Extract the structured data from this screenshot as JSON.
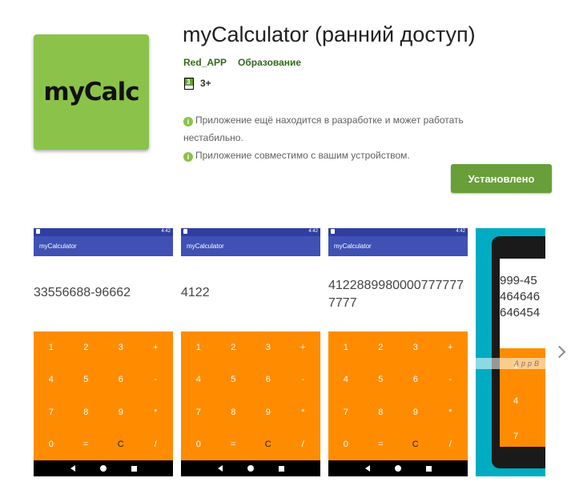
{
  "app": {
    "icon_text": "myCalc",
    "title": "myCalculator (ранний доступ)",
    "developer": "Red_APP",
    "category": "Образование",
    "rating_badge": "3",
    "rating": "3+",
    "notice1": "Приложение ещё находится в разработке и может работать нестабильно.",
    "notice2": "Приложение совместимо с вашим устройством.",
    "install_label": "Установлено"
  },
  "colors": {
    "accent": "#689f38",
    "icon_bg": "#8bc34a",
    "appbar": "#3f51b5",
    "keypad": "#ff8c00",
    "tablet_bg": "#00acc1"
  },
  "screenshots": [
    {
      "status_time": "4:42",
      "appbar_title": "myCalculator",
      "display": "33556688-96662",
      "keys": [
        "1",
        "2",
        "3",
        "+",
        "4",
        "5",
        "6",
        "-",
        "7",
        "8",
        "9",
        "*",
        "0",
        "=",
        "C",
        "/"
      ]
    },
    {
      "status_time": "4:42",
      "appbar_title": "myCalculator",
      "display": "4122",
      "keys": [
        "1",
        "2",
        "3",
        "+",
        "4",
        "5",
        "6",
        "-",
        "7",
        "8",
        "9",
        "*",
        "0",
        "=",
        "C",
        "/"
      ]
    },
    {
      "status_time": "4:42",
      "appbar_title": "myCalculator",
      "display": "41228899800007777777777",
      "keys": [
        "1",
        "2",
        "3",
        "+",
        "4",
        "5",
        "6",
        "-",
        "7",
        "8",
        "9",
        "*",
        "0",
        "=",
        "C",
        "/"
      ]
    }
  ],
  "tablet": {
    "display_lines": [
      "999-45",
      "464646",
      "646454"
    ],
    "keys": [
      "1",
      "4",
      "7"
    ],
    "watermark": "AppB"
  },
  "icons": {
    "info": "info-icon",
    "next": "chevron-right-icon"
  }
}
